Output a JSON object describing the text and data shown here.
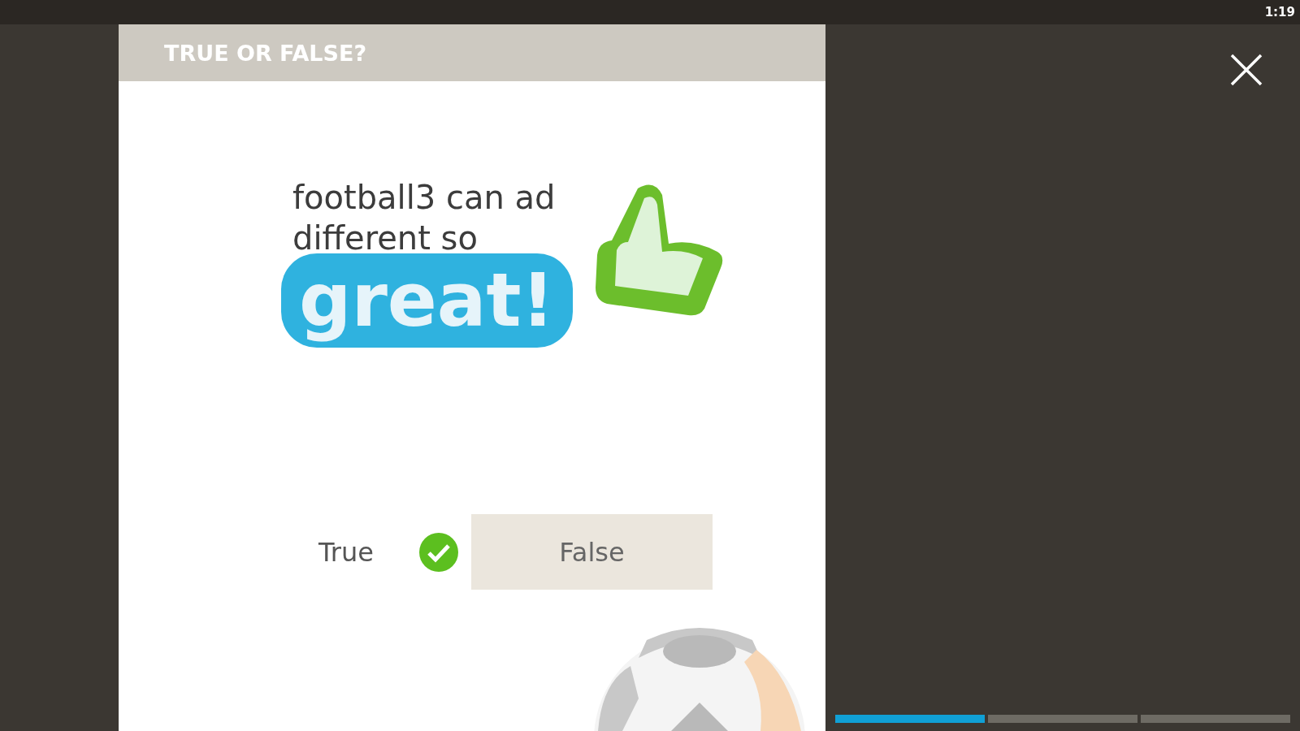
{
  "status_bar": {
    "time": "1:19"
  },
  "quiz": {
    "title": "TRUE OR FALSE?",
    "question_lines": [
      "football3 can ad",
      "different so"
    ],
    "sticker": {
      "text": "great!"
    },
    "options": [
      {
        "label": "True",
        "selected": true
      },
      {
        "label": "False",
        "selected": false
      }
    ]
  },
  "progress": [
    {
      "done": true
    },
    {
      "done": false
    },
    {
      "done": false
    }
  ]
}
